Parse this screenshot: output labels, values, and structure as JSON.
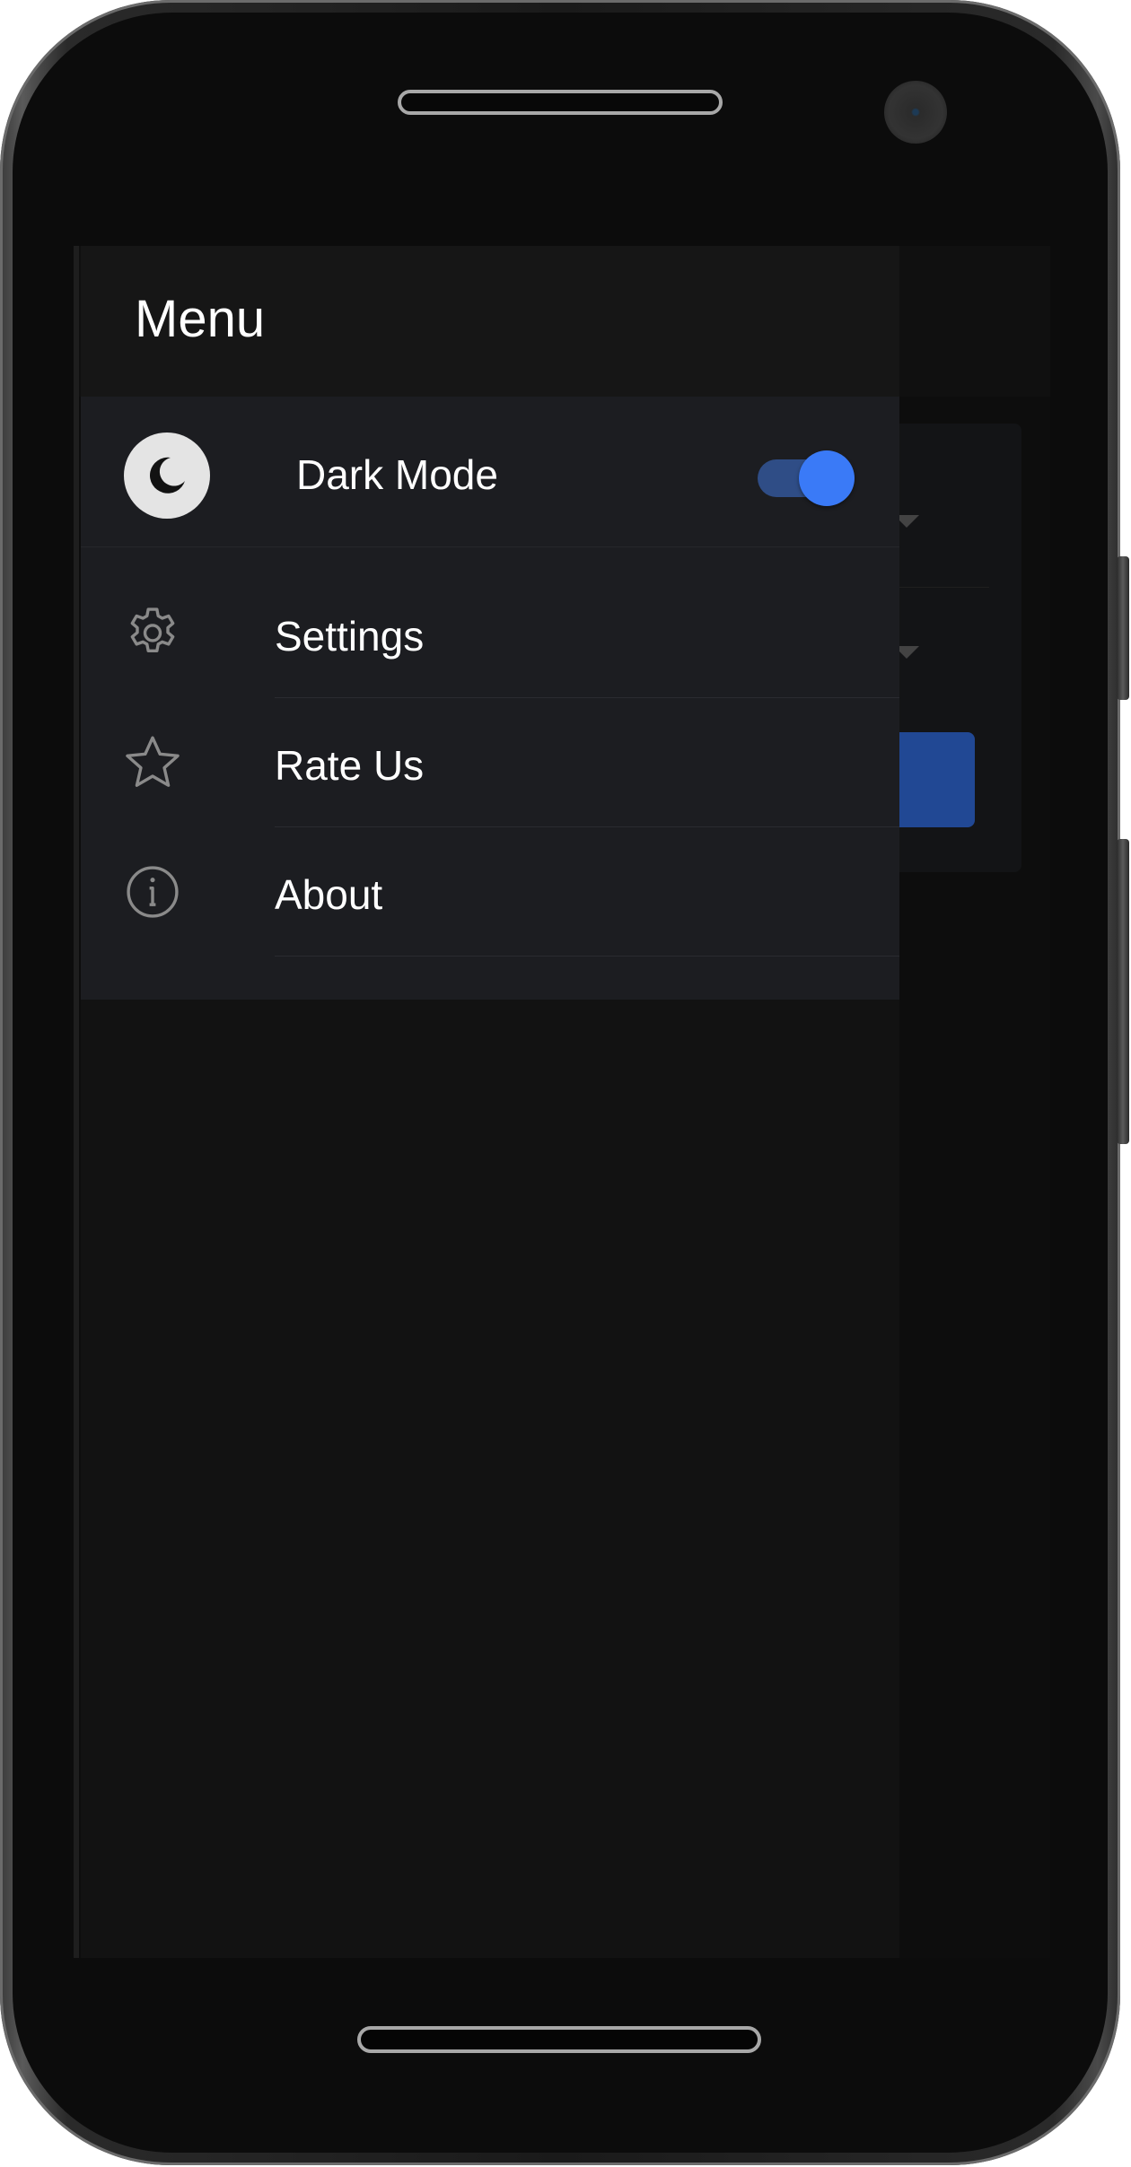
{
  "drawer": {
    "title": "Menu",
    "dark_mode": {
      "label": "Dark Mode",
      "enabled": true,
      "icon": "moon-icon"
    },
    "items": [
      {
        "label": "Settings",
        "icon": "gear-icon"
      },
      {
        "label": "Rate Us",
        "icon": "star-icon"
      },
      {
        "label": "About",
        "icon": "info-icon"
      }
    ]
  },
  "colors": {
    "accent": "#3a7af7",
    "background": "#121212",
    "drawer_list_bg": "#1c1d21",
    "icon_gray": "#8a8a8a"
  }
}
